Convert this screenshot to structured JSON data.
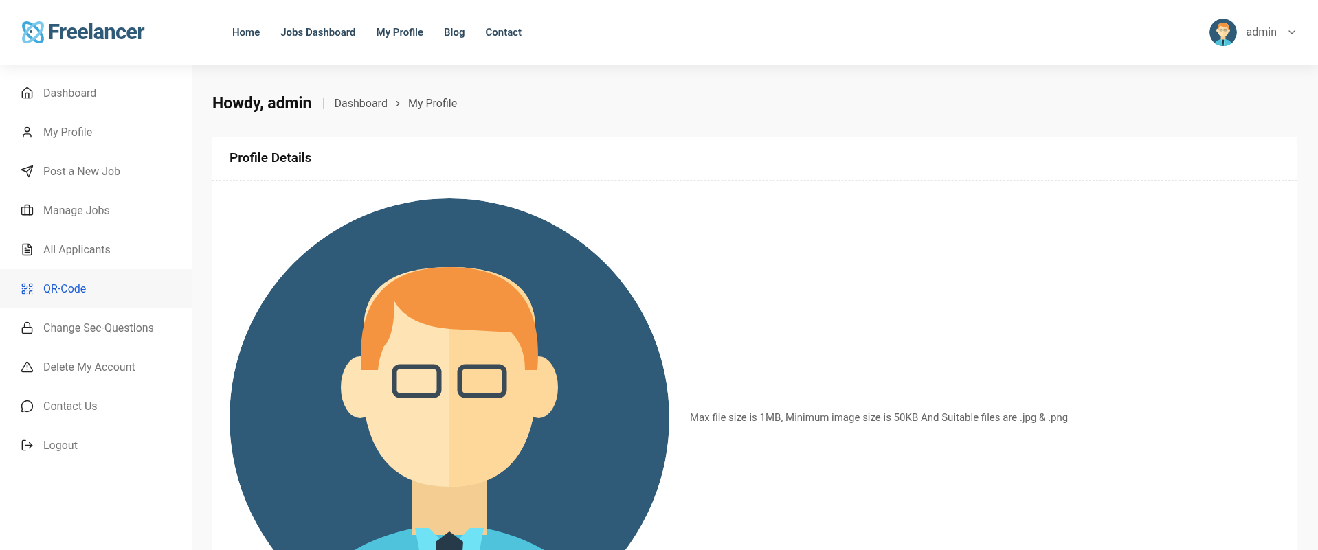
{
  "brand": {
    "name": "Freelancer"
  },
  "nav": [
    {
      "label": "Home"
    },
    {
      "label": "Jobs Dashboard"
    },
    {
      "label": "My Profile"
    },
    {
      "label": "Blog"
    },
    {
      "label": "Contact"
    }
  ],
  "user": {
    "name": "admin"
  },
  "sidebar": {
    "items": [
      {
        "label": "Dashboard",
        "kind": "home",
        "selected": false
      },
      {
        "label": "My Profile",
        "kind": "user",
        "selected": false
      },
      {
        "label": "Post a New Job",
        "kind": "send",
        "selected": false
      },
      {
        "label": "Manage Jobs",
        "kind": "briefcase",
        "selected": false
      },
      {
        "label": "All Applicants",
        "kind": "list",
        "selected": false
      },
      {
        "label": "QR-Code",
        "kind": "qr",
        "selected": true
      },
      {
        "label": "Change Sec-Questions",
        "kind": "lock",
        "selected": false
      },
      {
        "label": "Delete My Account",
        "kind": "warning",
        "selected": false
      },
      {
        "label": "Contact Us",
        "kind": "chat",
        "selected": false
      },
      {
        "label": "Logout",
        "kind": "logout",
        "selected": false
      }
    ]
  },
  "page": {
    "greeting": "Howdy, admin",
    "breadcrumb": [
      "Dashboard",
      "My Profile"
    ]
  },
  "card": {
    "title": "Profile Details",
    "hint": "Max file size is 1MB, Minimum image size is 50KB And Suitable files are .jpg & .png"
  }
}
